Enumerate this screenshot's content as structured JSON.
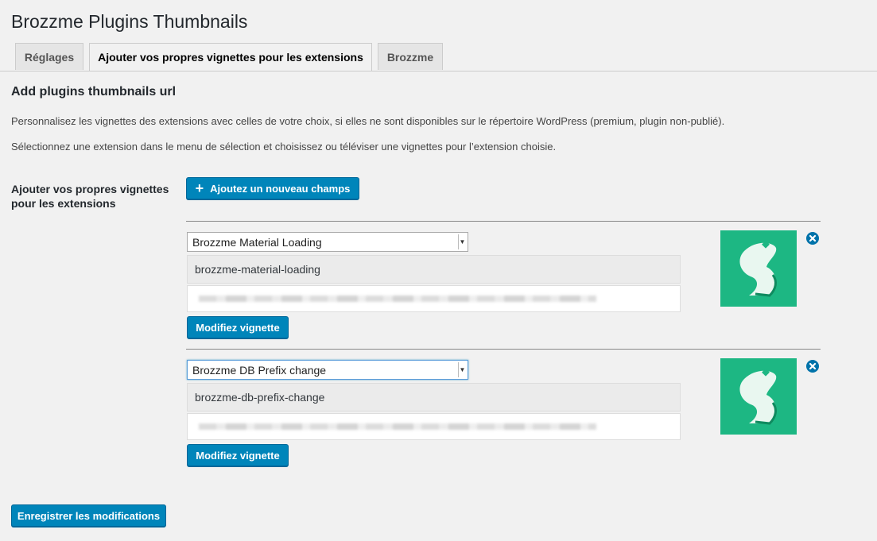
{
  "header": {
    "title": "Brozzme Plugins Thumbnails"
  },
  "tabs": [
    {
      "label": "Réglages",
      "active": false
    },
    {
      "label": "Ajouter vos propres vignettes pour les extensions",
      "active": true
    },
    {
      "label": "Brozzme",
      "active": false
    }
  ],
  "main": {
    "section_title": "Add plugins thumbnails url",
    "description_1": "Personnalisez les vignettes des extensions avec celles de votre choix, si elles ne sont disponibles sur le répertoire WordPress (premium, plugin non-publié).",
    "description_2": "Sélectionnez une extension dans le menu de sélection et choisissez ou téléviser une vignettes pour l’extension choisie.",
    "field_label": "Ajouter vos propres vignettes pour les extensions",
    "add_button_label": "Ajoutez un nouveau champs",
    "entries": [
      {
        "plugin_name": "Brozzme Material Loading",
        "slug": "brozzme-material-loading",
        "modify_label": "Modifiez vignette"
      },
      {
        "plugin_name": "Brozzme DB Prefix change",
        "slug": "brozzme-db-prefix-change",
        "modify_label": "Modifiez vignette"
      }
    ]
  },
  "footer": {
    "save_label": "Enregistrer les modifications"
  },
  "colors": {
    "accent": "#0085ba",
    "thumbnail_bg": "#1db783",
    "remove_icon": "#0073aa"
  },
  "icons": {
    "add": "plus-icon",
    "remove": "close-circle-icon",
    "select": "chevron-down-icon",
    "thumbnail": "brozzme-bird-logo"
  }
}
